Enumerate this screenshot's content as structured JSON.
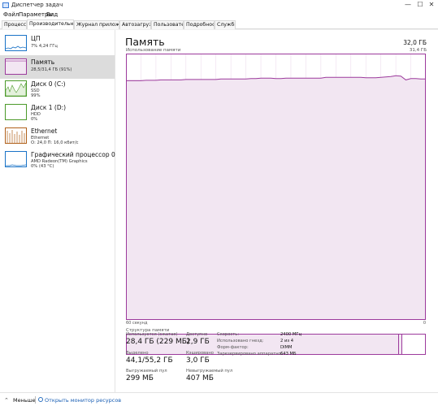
{
  "window": {
    "title": "Диспетчер задач",
    "buttons": {
      "minimize": "—",
      "maximize": "☐",
      "close": "✕"
    }
  },
  "menu": [
    "Файл",
    "Параметры",
    "Вид"
  ],
  "tabs": [
    {
      "label": "Процессы",
      "active": false
    },
    {
      "label": "Производительность",
      "active": true
    },
    {
      "label": "Журнал приложений",
      "active": false
    },
    {
      "label": "Автозагрузка",
      "active": false
    },
    {
      "label": "Пользователи",
      "active": false
    },
    {
      "label": "Подробности",
      "active": false
    },
    {
      "label": "Службы",
      "active": false
    }
  ],
  "sidebar": [
    {
      "name": "ЦП",
      "lines": [
        "7% 4,24 ГГц"
      ],
      "color": "#1a73c7",
      "icon": "cpu-graph"
    },
    {
      "name": "Память",
      "lines": [
        "28,5/31,4 ГБ (91%)"
      ],
      "color": "#9c3a9c",
      "icon": "memory-graph",
      "selected": true
    },
    {
      "name": "Диск 0 (C:)",
      "lines": [
        "SSD",
        "99%"
      ],
      "color": "#4c9a2a",
      "icon": "disk-graph"
    },
    {
      "name": "Диск 1 (D:)",
      "lines": [
        "HDD",
        "0%"
      ],
      "color": "#4c9a2a",
      "icon": "disk-graph"
    },
    {
      "name": "Ethernet",
      "lines": [
        "Ethernet",
        "О: 24,0 П: 16,0 кбит/с"
      ],
      "color": "#b0601a",
      "icon": "ethernet-graph"
    },
    {
      "name": "Графический процессор 0",
      "lines": [
        "AMD Radeon(TM) Graphics",
        "0% (43 °C)"
      ],
      "color": "#1a73c7",
      "icon": "gpu-graph"
    }
  ],
  "main": {
    "title": "Память",
    "total": "32,0 ГБ",
    "chart_label": "Использование памяти",
    "chart_max": "31,4 ГБ",
    "axis_left": "60 секунд",
    "axis_right": "0",
    "struct_label": "Структура памяти",
    "stats": {
      "used_label": "Используется (сжатая)",
      "used_value": "28,4 ГБ (229 МБ)",
      "avail_label": "Доступно",
      "avail_value": "2,9 ГБ",
      "commit_label": "Выделено",
      "commit_value": "44,1/55,2 ГБ",
      "cached_label": "Кэшировано",
      "cached_value": "3,0 ГБ",
      "paged_label": "Выгружаемый пул",
      "paged_value": "299 МБ",
      "nonpaged_label": "Невыгружаемый пул",
      "nonpaged_value": "407 МБ"
    },
    "specs": [
      {
        "k": "Скорость:",
        "v": "2400 МГц"
      },
      {
        "k": "Использовано гнезд:",
        "v": "2 из 4"
      },
      {
        "k": "Форм-фактор:",
        "v": "DIMM"
      },
      {
        "k": "Зарезервировано аппаратно:",
        "v": "643 МБ"
      }
    ]
  },
  "footer": {
    "less": "Меньше",
    "link": "Открыть монитор ресурсов"
  },
  "chart_data": {
    "type": "area",
    "title": "Использование памяти",
    "xlabel": "",
    "ylabel": "",
    "x_range": [
      "60 секунд",
      "0"
    ],
    "ylim": [
      0,
      31.4
    ],
    "unit": "ГБ",
    "grid": true,
    "color": "#9c3a9c",
    "series": [
      {
        "values": [
          28.2,
          28.2,
          28.2,
          28.2,
          28.25,
          28.25,
          28.25,
          28.3,
          28.3,
          28.3,
          28.3,
          28.3,
          28.35,
          28.35,
          28.35,
          28.35,
          28.35,
          28.35,
          28.35,
          28.4,
          28.4,
          28.4,
          28.4,
          28.4,
          28.4,
          28.45,
          28.45,
          28.5,
          28.5,
          28.5,
          28.45,
          28.45,
          28.5,
          28.5,
          28.5,
          28.5,
          28.5,
          28.5,
          28.5,
          28.5,
          28.6,
          28.6,
          28.6,
          28.6,
          28.6,
          28.6,
          28.6,
          28.6,
          28.55,
          28.55,
          28.55,
          28.6,
          28.65,
          28.7,
          28.8,
          28.75,
          28.3,
          28.45,
          28.45,
          28.4,
          28.4
        ]
      }
    ]
  }
}
